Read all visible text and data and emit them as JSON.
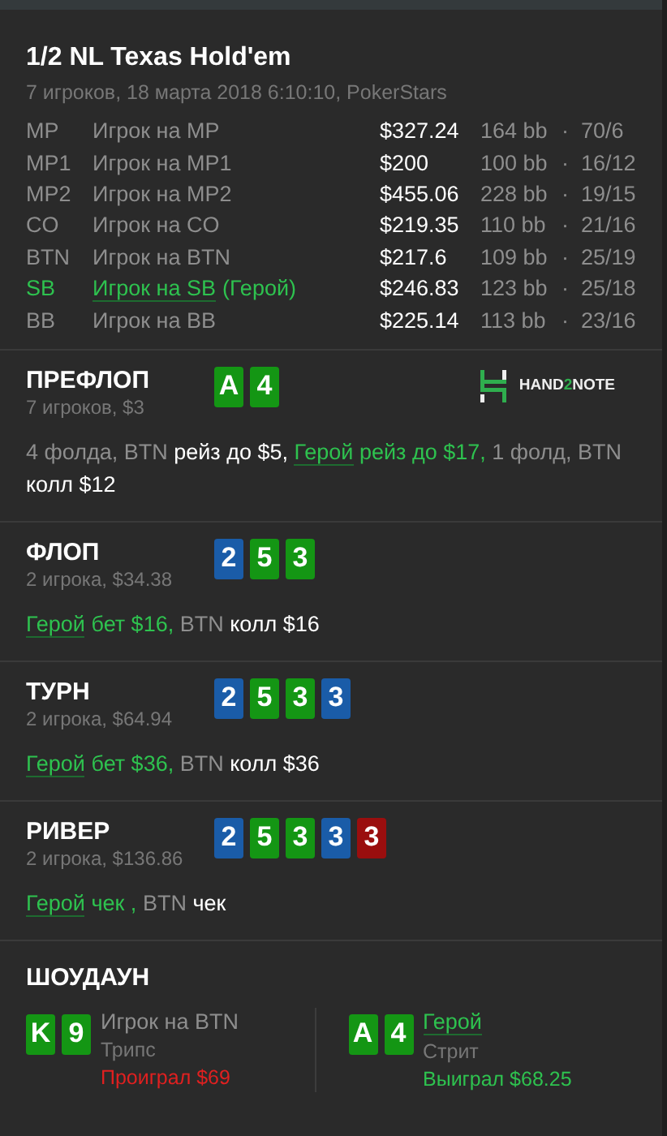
{
  "title": "1/2 NL Texas Hold'em",
  "subtitle": "7 игроков, 18 марта 2018 6:10:10, PokerStars",
  "players": [
    {
      "position": "MP",
      "name": "Игрок на MP",
      "hero": false,
      "stack": "$327.24",
      "bb": "164 bb",
      "separator": "·",
      "stats": "70/6"
    },
    {
      "position": "MP1",
      "name": "Игрок на MP1",
      "hero": false,
      "stack": "$200",
      "bb": "100 bb",
      "separator": "·",
      "stats": "16/12"
    },
    {
      "position": "MP2",
      "name": "Игрок на MP2",
      "hero": false,
      "stack": "$455.06",
      "bb": "228 bb",
      "separator": "·",
      "stats": "19/15"
    },
    {
      "position": "CO",
      "name": "Игрок на CO",
      "hero": false,
      "stack": "$219.35",
      "bb": "110 bb",
      "separator": "·",
      "stats": "21/16"
    },
    {
      "position": "BTN",
      "name": "Игрок на BTN",
      "hero": false,
      "stack": "$217.6",
      "bb": "109 bb",
      "separator": "·",
      "stats": "25/19"
    },
    {
      "position": "SB",
      "name": "Игрок на SB",
      "hero": true,
      "hero_tag": "(Герой)",
      "stack": "$246.83",
      "bb": "123 bb",
      "separator": "·",
      "stats": "25/18"
    },
    {
      "position": "BB",
      "name": "Игрок на BB",
      "hero": false,
      "stack": "$225.14",
      "bb": "113 bb",
      "separator": "·",
      "stats": "23/16"
    }
  ],
  "streets": [
    {
      "name": "ПРЕФЛОП",
      "info": "7 игроков, $3",
      "logo": {
        "text_1": "HAND",
        "text_2": "2",
        "text_3": "NOTE"
      },
      "cards": [
        {
          "rank": "A",
          "color": "#149614"
        },
        {
          "rank": "4",
          "color": "#149614"
        }
      ],
      "actions": [
        {
          "text": "4 фолда, BTN ",
          "kind": "muted"
        },
        {
          "text": "рейз до $5, ",
          "kind": "bold"
        },
        {
          "text": "Герой",
          "kind": "link"
        },
        {
          "text": " рейз до $17, ",
          "kind": "hero"
        },
        {
          "text": "1 фолд, BTN ",
          "kind": "muted"
        },
        {
          "text": "колл $12",
          "kind": "bold"
        }
      ]
    },
    {
      "name": "ФЛОП",
      "info": "2 игрока, $34.38",
      "cards": [
        {
          "rank": "2",
          "color": "#1a5ca8"
        },
        {
          "rank": "5",
          "color": "#149614"
        },
        {
          "rank": "3",
          "color": "#149614"
        }
      ],
      "actions": [
        {
          "text": "Герой",
          "kind": "link"
        },
        {
          "text": " бет $16, ",
          "kind": "hero"
        },
        {
          "text": "BTN ",
          "kind": "muted"
        },
        {
          "text": "колл $16",
          "kind": "bold"
        }
      ]
    },
    {
      "name": "ТУРН",
      "info": "2 игрока, $64.94",
      "cards": [
        {
          "rank": "2",
          "color": "#1a5ca8"
        },
        {
          "rank": "5",
          "color": "#149614"
        },
        {
          "rank": "3",
          "color": "#149614"
        },
        {
          "rank": "3",
          "color": "#1a5ca8"
        }
      ],
      "actions": [
        {
          "text": "Герой",
          "kind": "link"
        },
        {
          "text": " бет $36, ",
          "kind": "hero"
        },
        {
          "text": "BTN ",
          "kind": "muted"
        },
        {
          "text": "колл $36",
          "kind": "bold"
        }
      ]
    },
    {
      "name": "РИВЕР",
      "info": "2 игрока, $136.86",
      "cards": [
        {
          "rank": "2",
          "color": "#1a5ca8"
        },
        {
          "rank": "5",
          "color": "#149614"
        },
        {
          "rank": "3",
          "color": "#149614"
        },
        {
          "rank": "3",
          "color": "#1a5ca8"
        },
        {
          "rank": "3",
          "color": "#9a0e0e"
        }
      ],
      "actions": [
        {
          "text": "Герой",
          "kind": "link"
        },
        {
          "text": " чек , ",
          "kind": "hero"
        },
        {
          "text": "BTN ",
          "kind": "muted"
        },
        {
          "text": "чек",
          "kind": "bold"
        }
      ]
    }
  ],
  "showdown": {
    "title": "ШОУДАУН",
    "hands": [
      {
        "cards": [
          {
            "rank": "K",
            "color": "#149614"
          },
          {
            "rank": "9",
            "color": "#149614"
          }
        ],
        "name": "Игрок на BTN",
        "hero": false,
        "combination": "Трипс",
        "result": "Проиграл $69",
        "won": false
      },
      {
        "cards": [
          {
            "rank": "A",
            "color": "#149614"
          },
          {
            "rank": "4",
            "color": "#149614"
          }
        ],
        "name": "Герой",
        "hero": true,
        "combination": "Стрит",
        "result": "Выиграл $68.25",
        "won": true
      }
    ]
  }
}
